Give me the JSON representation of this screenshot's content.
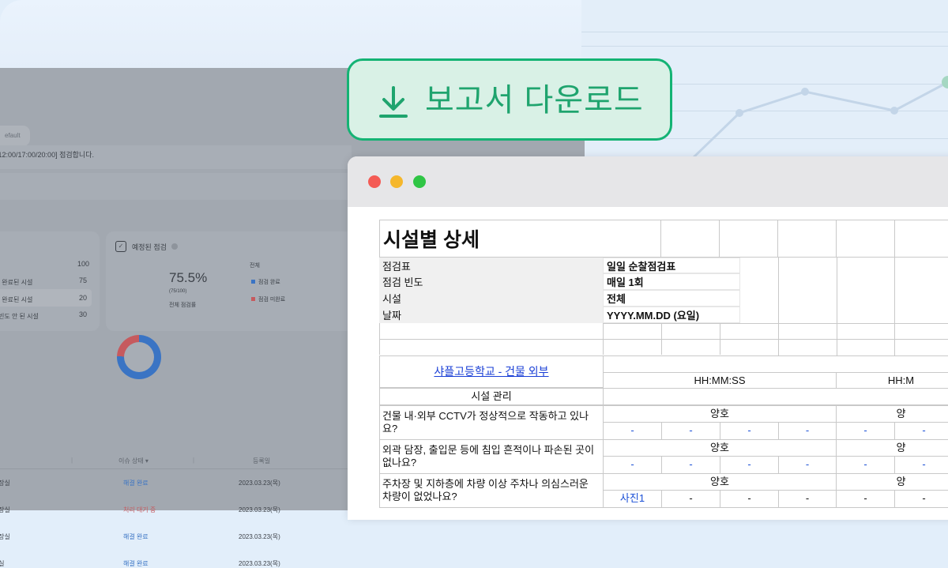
{
  "colors": {
    "accent_green": "#14b374",
    "button_bg": "#d9f1e6",
    "link_blue": "#1a3fd6",
    "donut_complete": "#3a74c4",
    "donut_incomplete": "#c65a5e"
  },
  "download_button": {
    "label": "보고서 다운로드",
    "icon": "download-icon"
  },
  "dashboard": {
    "pill_label": "efault",
    "schedule_text": "0/12:00/17:00/20:00] 점검합니다.",
    "card_a": {
      "total": "100",
      "rows": [
        {
          "label": "| 완료된 시설",
          "value": "75"
        },
        {
          "label": "| 완료된 시설",
          "value": "20"
        },
        {
          "label": "빈도 안 된 시설",
          "value": "30"
        }
      ]
    },
    "card_b": {
      "title": "예정된 점검",
      "icon": "calendar-check-icon",
      "percent": "75.5%",
      "ratio": "(75/100)",
      "sub": "전체 점검률",
      "legend_title": "전체",
      "legend": [
        "점검 완료",
        "점검 미완료"
      ],
      "complete_fraction": 0.755
    },
    "table": {
      "status_header": "이슈 상태 ▾",
      "date_header": "등록일",
      "rows": [
        {
          "name": "|장실",
          "status": "해결 완료",
          "date": "2023.03.23(목)",
          "status_color": "#3a74c4"
        },
        {
          "name": "|장실",
          "status": "처리 대기 중",
          "date": "2023.03.23(목)",
          "status_color": "#c65a5e"
        },
        {
          "name": "|장실",
          "status": "해결 완료",
          "date": "2023.03.23(목)",
          "status_color": "#3a74c4"
        },
        {
          "name": "|실",
          "status": "해결 완료",
          "date": "2023.03.23(목)",
          "status_color": "#3a74c4"
        }
      ]
    }
  },
  "sheet": {
    "title": "시설별 상세",
    "meta": [
      {
        "label": "점검표",
        "value": "일일 순찰점검표"
      },
      {
        "label": "점검 빈도",
        "value": "매일 1회"
      },
      {
        "label": "시설",
        "value": "전체"
      },
      {
        "label": "날짜",
        "value": "YYYY.MM.DD (요일)"
      }
    ],
    "facility_link": "샤플고등학교 - 건물 외부",
    "time_1": "HH:MM:SS",
    "time_2": "HH:M",
    "section": "시설 관리",
    "questions": [
      {
        "text": "건물 내·외부 CCTV가 정상적으로 작동하고 있나요?",
        "result": "양호",
        "marks": [
          "-",
          "-",
          "-",
          "-",
          "-",
          "-"
        ]
      },
      {
        "text": "외곽 담장, 출입문 등에 침입 흔적이나 파손된 곳이 없나요?",
        "result": "양호",
        "marks": [
          "-",
          "-",
          "-",
          "-",
          "-",
          "-"
        ]
      },
      {
        "text": "주차장 및 지하층에 차량 이상 주차나 의심스러운 차량이 없었나요?",
        "result": "양호",
        "marks": [
          "사진1",
          "-",
          "-",
          "-",
          "-",
          "-"
        ]
      }
    ],
    "result_right": "양"
  }
}
